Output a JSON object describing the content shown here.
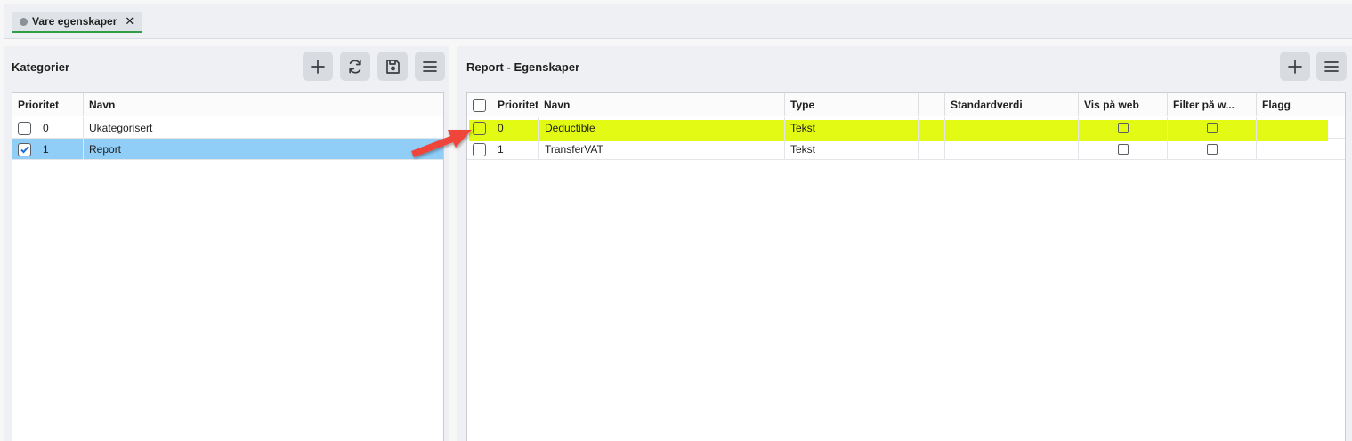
{
  "tab": {
    "label": "Vare egenskaper",
    "close_glyph": "✕"
  },
  "left_panel": {
    "title": "Kategorier",
    "buttons": [
      "plus-icon",
      "refresh-icon",
      "save-icon",
      "menu-icon"
    ],
    "columns": [
      "Prioritet",
      "Navn"
    ],
    "rows": [
      {
        "checked": false,
        "prioritet": "0",
        "navn": "Ukategorisert"
      },
      {
        "checked": true,
        "prioritet": "1",
        "navn": "Report"
      }
    ]
  },
  "right_panel": {
    "title": "Report - Egenskaper",
    "buttons": [
      "plus-icon",
      "menu-icon"
    ],
    "columns": [
      "Prioritet",
      "Navn",
      "Type",
      "",
      "Standardverdi",
      "Vis på web",
      "Filter på w...",
      "Flagg"
    ],
    "rows": [
      {
        "prioritet": "0",
        "navn": "Deductible",
        "type": "Tekst",
        "standardverdi": "",
        "vis_paa_web": false,
        "filter_paa_web": false,
        "flagg": ""
      },
      {
        "prioritet": "1",
        "navn": "TransferVAT",
        "type": "Tekst",
        "standardverdi": "",
        "vis_paa_web": false,
        "filter_paa_web": false,
        "flagg": ""
      }
    ]
  },
  "colors": {
    "highlight": "#e0fa00",
    "selected_row": "#90cdf7",
    "arrow": "#f0453b",
    "tab_underline": "#2f9e44"
  }
}
